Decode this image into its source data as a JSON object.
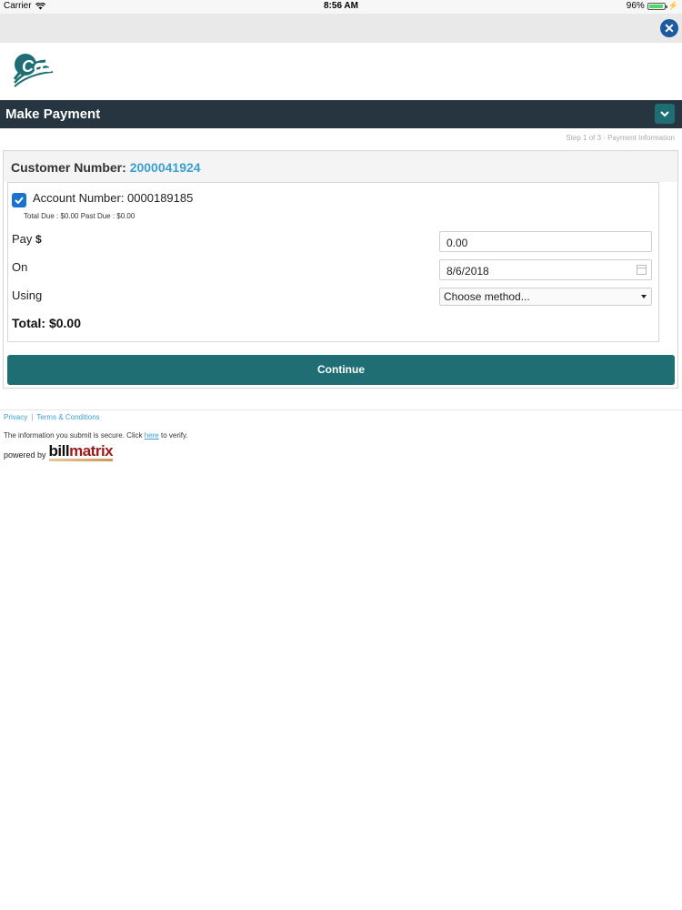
{
  "status_bar": {
    "carrier": "Carrier",
    "time": "8:56 AM",
    "battery": "96%",
    "battery_level": 0.96
  },
  "close_icon": "close-circle-icon",
  "logo_text": "CoServ",
  "header": {
    "title": "Make Payment",
    "toggle_icon": "chevron-down-icon"
  },
  "step_text": "Step 1 of 3 - Payment Information",
  "customer": {
    "label": "Customer Number:",
    "number": "2000041924"
  },
  "account": {
    "label": "Account Number: 0000189185",
    "checked": true,
    "due_line": "Total Due : $0.00 Past Due : $0.00"
  },
  "form": {
    "pay_label": "Pay",
    "pay_currency": "$",
    "pay_value": "0.00",
    "on_label": "On",
    "on_value": "8/6/2018",
    "using_label": "Using",
    "using_value": "Choose method..."
  },
  "total": "Total: $0.00",
  "continue_label": "Continue",
  "footer": {
    "privacy": "Privacy",
    "separator": "|",
    "terms": "Terms & Conditions",
    "secure_prefix": "The information you submit is secure. Click ",
    "secure_link": "here",
    "secure_suffix": " to verify.",
    "powered_by": "powered by",
    "billmatrix_bill": "bill",
    "billmatrix_matrix": "matrix"
  },
  "colors": {
    "header_bg": "#263540",
    "accent": "#1e6e74",
    "link": "#3b9fd0",
    "checkbox": "#1a73d1"
  }
}
